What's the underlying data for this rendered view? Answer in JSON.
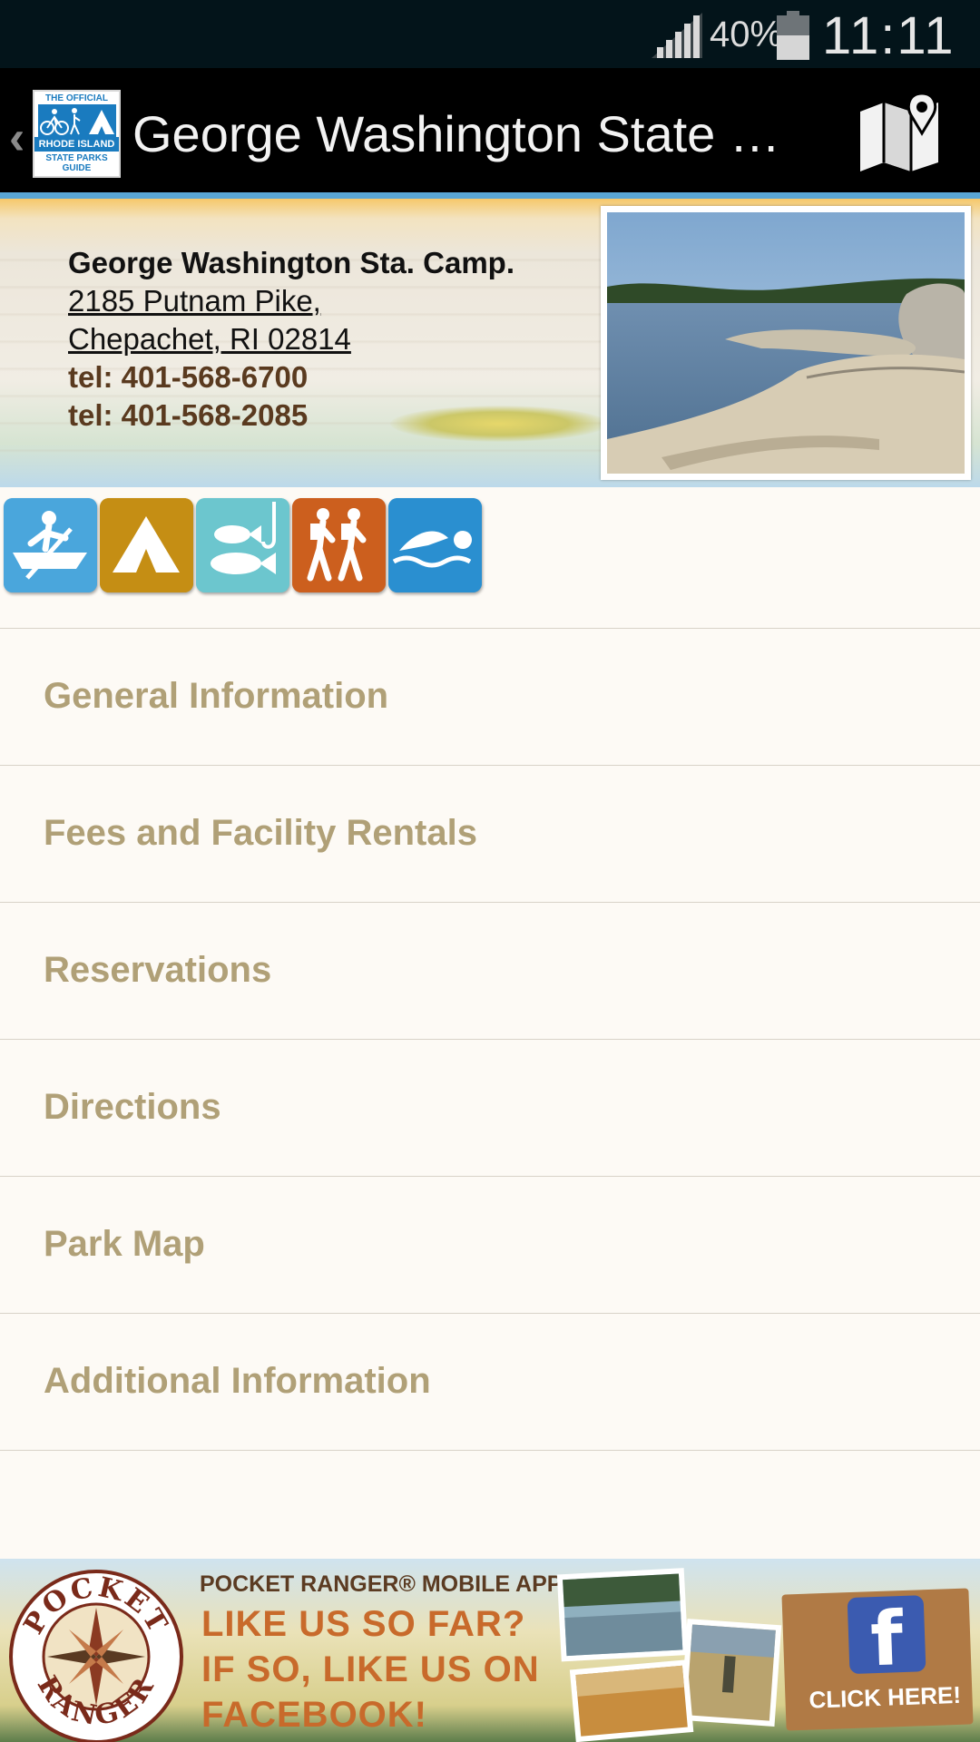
{
  "status_bar": {
    "battery_percent": "40%",
    "time": "11:11",
    "signal_icon": "cell-signal-icon",
    "battery_icon": "battery-icon"
  },
  "app_bar": {
    "logo": {
      "line1": "THE OFFICIAL",
      "line2": "RHODE ISLAND",
      "line3": "STATE PARKS",
      "line4": "GUIDE"
    },
    "title": "George Washington State Ca…",
    "map_icon": "map-pin-icon",
    "colors": {
      "bar": "#000000",
      "accent": "#5aa6d4"
    }
  },
  "park": {
    "name": "George Washington Sta. Camp.",
    "address_line1": "2185 Putnam Pike,",
    "address_line2": "Chepachet, RI 02814",
    "tel1": "tel: 401-568-6700",
    "tel2": "tel: 401-568-2085"
  },
  "activities": [
    {
      "icon": "boating-icon",
      "color": "#4aa6dc"
    },
    {
      "icon": "camping-icon",
      "color": "#c58e14"
    },
    {
      "icon": "fishing-icon",
      "color": "#6cc6ce"
    },
    {
      "icon": "hiking-icon",
      "color": "#cc5f1e"
    },
    {
      "icon": "swimming-icon",
      "color": "#2a8fd0"
    }
  ],
  "menu": [
    "General Information",
    "Fees and Facility Rentals",
    "Reservations",
    "Directions",
    "Park Map",
    "Additional Information"
  ],
  "banner": {
    "brand_top": "POCKET",
    "brand_bottom": "RANGER",
    "kicker": "POCKET RANGER® MOBILE APPS",
    "line1": "LIKE US SO FAR?",
    "line2": "IF SO, LIKE US ON",
    "line3": "FACEBOOK!",
    "facebook_glyph": "f",
    "cta": "CLICK HERE!"
  },
  "colors": {
    "menu_text": "#b0a077",
    "background": "#fdfaf5",
    "tel_text": "#5a3a1f"
  }
}
